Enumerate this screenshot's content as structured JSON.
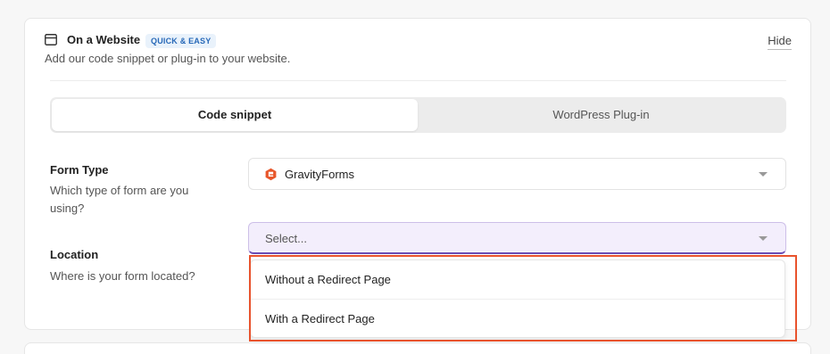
{
  "header": {
    "title": "On a Website",
    "badge": "QUICK & EASY",
    "hide_label": "Hide",
    "subtitle": "Add our code snippet or plug-in to your website.",
    "icon": "browser-window-icon"
  },
  "tabs": [
    {
      "label": "Code snippet",
      "active": true
    },
    {
      "label": "WordPress Plug-in",
      "active": false
    }
  ],
  "form_type": {
    "label": "Form Type",
    "help": "Which type of form are you using?",
    "value": "GravityForms",
    "icon": "gravityforms-icon"
  },
  "location": {
    "label": "Location",
    "help": "Where is your form located?",
    "placeholder": "Select...",
    "options": [
      "Without a Redirect Page",
      "With a Redirect Page"
    ]
  },
  "colors": {
    "highlight": "#e8532d",
    "badge_bg": "#e9f2fb",
    "badge_text": "#2869b8",
    "select_open_bg": "#f3eefc",
    "select_open_border": "#6a4bb3",
    "gravityforms": "#e8572b"
  }
}
